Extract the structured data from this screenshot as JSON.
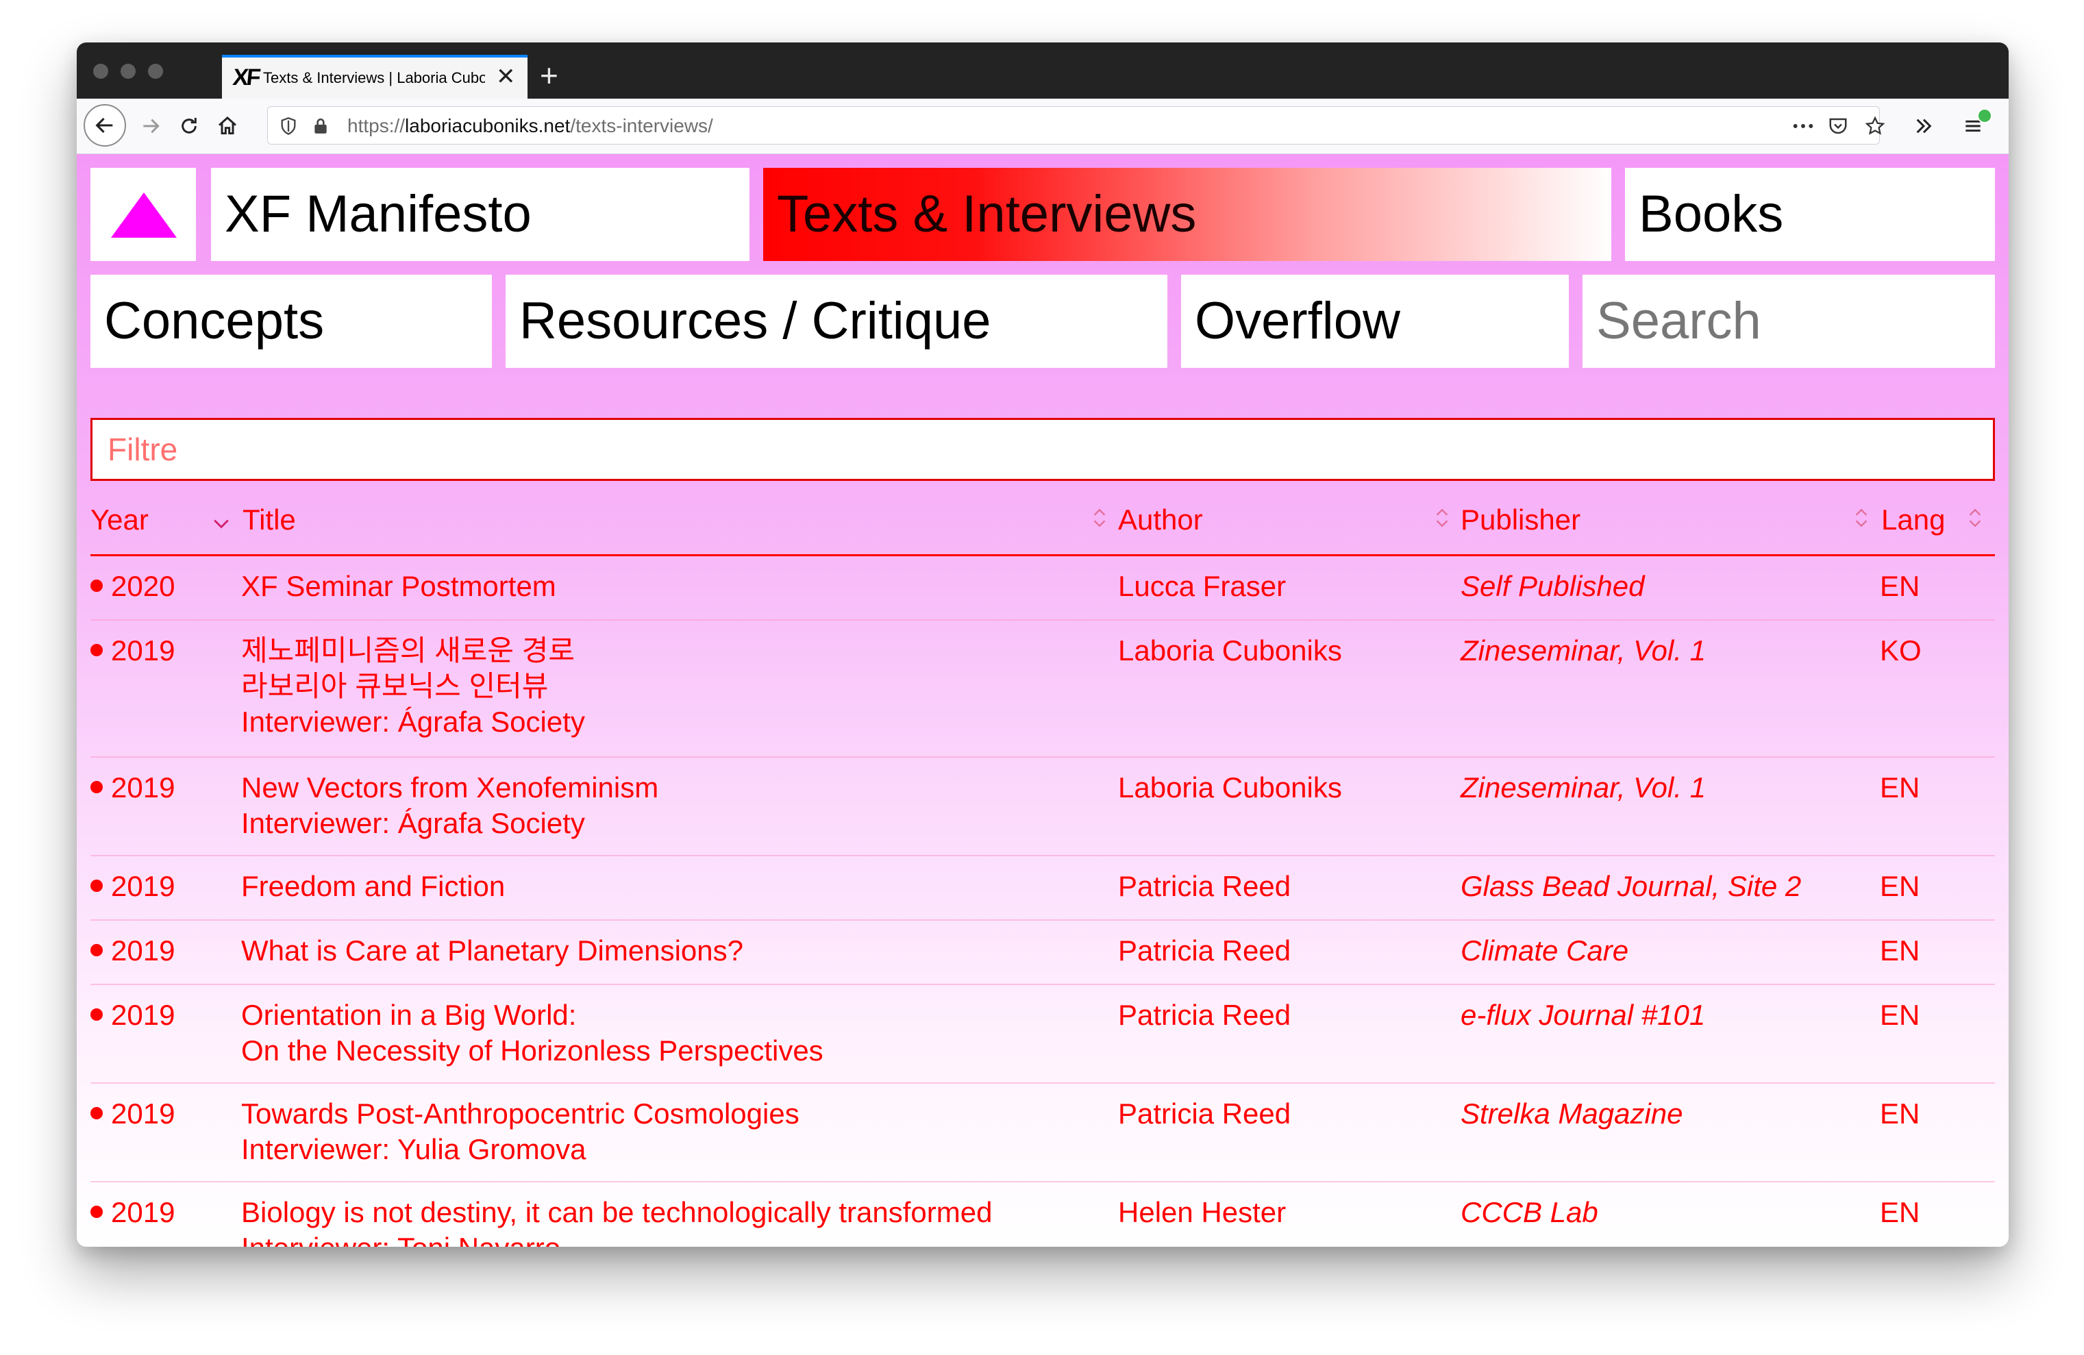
{
  "browser": {
    "tab_title": "Texts & Interviews | Laboria Cuboniks",
    "tab_logo": "XF",
    "new_tab_label": "+",
    "close_tab_label": "✕",
    "url_scheme": "https://",
    "url_host": "laboriacuboniks.net",
    "url_path": "/texts-interviews/",
    "icons": [
      "back-arrow-icon",
      "forward-arrow-icon",
      "reload-icon",
      "home-icon",
      "shield-icon",
      "lock-icon",
      "more-icon",
      "pocket-icon",
      "star-icon",
      "overflow-chevrons-icon",
      "hamburger-menu-icon"
    ]
  },
  "nav": {
    "logo": "triangle-logo-icon",
    "manifesto": "XF Manifesto",
    "texts": "Texts & Interviews",
    "books": "Books",
    "concepts": "Concepts",
    "resources": "Resources / Critique",
    "overflow": "Overflow",
    "search_placeholder": "Search"
  },
  "filter": {
    "placeholder": "Filtre"
  },
  "table": {
    "headers": {
      "year": "Year",
      "title": "Title",
      "author": "Author",
      "publisher": "Publisher",
      "lang": "Lang"
    },
    "rows": [
      {
        "year": "2020",
        "title": [
          "XF Seminar Postmortem"
        ],
        "author": "Lucca Fraser",
        "publisher": "Self Published",
        "lang": "EN"
      },
      {
        "year": "2019",
        "title": [
          "제노페미니즘의 새로운 경로",
          "라보리아 큐보닉스 인터뷰",
          "Interviewer: Ágrafa Society"
        ],
        "author": "Laboria Cuboniks",
        "publisher": "Zineseminar, Vol. 1",
        "lang": "KO"
      },
      {
        "year": "2019",
        "title": [
          "New Vectors from Xenofeminism",
          "Interviewer: Ágrafa Society"
        ],
        "author": "Laboria Cuboniks",
        "publisher": "Zineseminar, Vol. 1",
        "lang": "EN"
      },
      {
        "year": "2019",
        "title": [
          "Freedom and Fiction"
        ],
        "author": "Patricia Reed",
        "publisher": "Glass Bead Journal, Site 2",
        "lang": "EN"
      },
      {
        "year": "2019",
        "title": [
          "What is Care at Planetary Dimensions?"
        ],
        "author": "Patricia Reed",
        "publisher": "Climate Care",
        "lang": "EN"
      },
      {
        "year": "2019",
        "title": [
          "Orientation in a Big World:",
          "On the Necessity of Horizonless Perspectives"
        ],
        "author": "Patricia Reed",
        "publisher": "e-flux Journal #101",
        "lang": "EN"
      },
      {
        "year": "2019",
        "title": [
          "Towards Post-Anthropocentric Cosmologies",
          "Interviewer: Yulia Gromova"
        ],
        "author": "Patricia Reed",
        "publisher": "Strelka Magazine",
        "lang": "EN"
      },
      {
        "year": "2019",
        "title": [
          "Biology is not destiny, it can be technologically transformed",
          "Interviewer: Toni Navarro"
        ],
        "author": "Helen Hester",
        "publisher": "CCCB Lab",
        "lang": "EN"
      }
    ]
  },
  "colors": {
    "accent": "#ff0000",
    "page_bg": "#f498f7",
    "logo": "#ff00ff"
  }
}
